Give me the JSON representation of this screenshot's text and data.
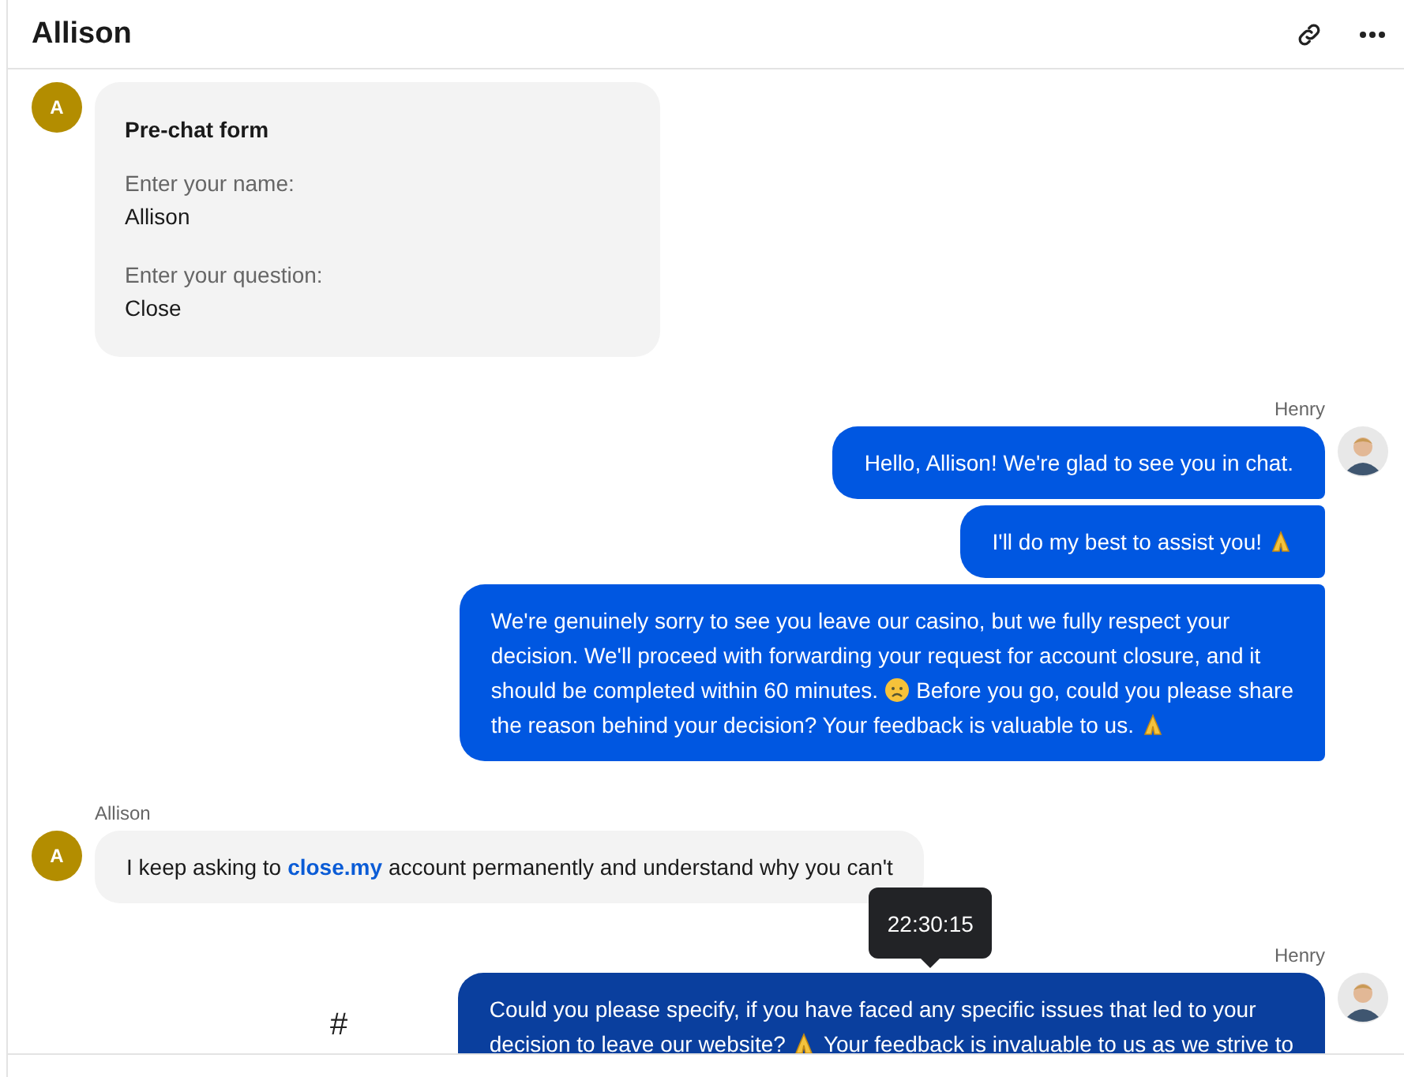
{
  "header": {
    "title": "Allison"
  },
  "messages": [
    {
      "kind": "form",
      "avatar": "A",
      "form": {
        "title": "Pre-chat form",
        "fields": [
          {
            "label": "Enter your name:",
            "value": "Allison"
          },
          {
            "label": "Enter your question:",
            "value": "Close"
          }
        ]
      }
    },
    {
      "kind": "agent",
      "sender": "Henry",
      "bubbles": [
        {
          "hovered": false,
          "lines": [
            [
              {
                "kind": "text",
                "text": "Hello, Allison! We're glad to see you in chat."
              }
            ]
          ]
        },
        {
          "hovered": false,
          "lines": [
            [
              {
                "kind": "text",
                "text": "I'll do my best to assist you!"
              },
              {
                "kind": "pray"
              }
            ]
          ]
        },
        {
          "hovered": false,
          "lines": [
            [
              {
                "kind": "text",
                "text": "We're genuinely sorry to see you leave our casino, but we fully respect your"
              }
            ],
            [
              {
                "kind": "text",
                "text": "decision. We'll proceed with forwarding your request for account closure, and it"
              }
            ],
            [
              {
                "kind": "text",
                "text": "should be completed within 60 minutes."
              },
              {
                "kind": "sad"
              },
              {
                "kind": "text",
                "text": "Before you go, could you please share"
              }
            ],
            [
              {
                "kind": "text",
                "text": "the reason behind your decision? Your feedback is valuable to us."
              },
              {
                "kind": "pray"
              }
            ]
          ]
        }
      ]
    },
    {
      "kind": "visitor",
      "sender": "Allison",
      "avatar": "A",
      "bubbles": [
        {
          "lines": [
            [
              {
                "kind": "text",
                "text": "I keep asking to"
              },
              {
                "kind": "link",
                "text": "close.my"
              },
              {
                "kind": "text",
                "text": "account permanently and understand why you can't"
              }
            ]
          ]
        }
      ]
    },
    {
      "kind": "agent",
      "sender": "Henry",
      "mark": "#",
      "bubbles": [
        {
          "hovered": true,
          "tooltip": "22:30:15",
          "lines": [
            [
              {
                "kind": "text",
                "text": "Could you please specify, if you have faced any specific issues that led to your"
              }
            ],
            [
              {
                "kind": "text",
                "text": "decision to leave our website?"
              },
              {
                "kind": "pray"
              },
              {
                "kind": "text",
                "text": "Your feedback is invaluable to us as we strive to"
              }
            ]
          ]
        }
      ]
    }
  ]
}
